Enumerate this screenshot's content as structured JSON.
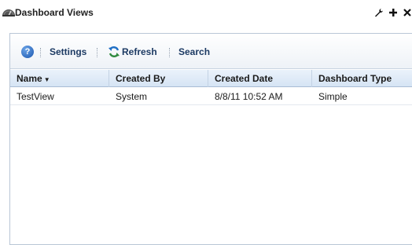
{
  "window": {
    "title": "Dashboard Views",
    "icon": "dashboard-gauge-icon",
    "controls": [
      "wrench-icon",
      "plus-icon",
      "close-icon"
    ]
  },
  "toolbar": {
    "help_icon": "help-icon",
    "settings_label": "Settings",
    "refresh_label": "Refresh",
    "search_label": "Search"
  },
  "table": {
    "columns": [
      "Name",
      "Created By",
      "Created Date",
      "Dashboard Type"
    ],
    "sort_column": "Name",
    "sort_direction": "descending",
    "rows": [
      [
        "TestView",
        "System",
        "8/8/11 10:52 AM",
        "Simple"
      ]
    ]
  },
  "colors": {
    "accent": "#1c3a63",
    "header_bg": "#d6e4f4",
    "border": "#b9c6d6"
  }
}
